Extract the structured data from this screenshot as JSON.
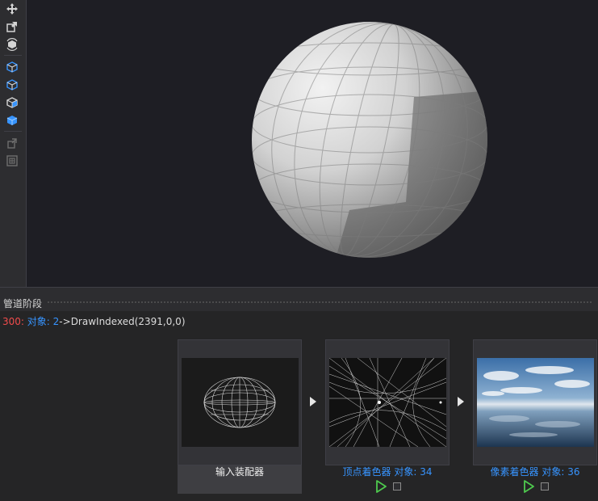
{
  "toolbar": {
    "tools": [
      {
        "name": "move-icon",
        "color": "#d4d4d4"
      },
      {
        "name": "scale-icon",
        "color": "#d4d4d4"
      },
      {
        "name": "rotate-icon",
        "color": "#d4d4d4"
      },
      {
        "name": "cube-view-icon-1",
        "color": "#3794ff"
      },
      {
        "name": "cube-view-icon-2",
        "color": "#3794ff"
      },
      {
        "name": "cube-view-icon-3",
        "color": "#3794ff"
      },
      {
        "name": "cube-solid-icon",
        "color": "#3794ff"
      },
      {
        "name": "export-icon",
        "color": "#6e6e6e"
      },
      {
        "name": "layout-icon",
        "color": "#6e6e6e"
      }
    ]
  },
  "panel": {
    "title": "管道阶段"
  },
  "drawcall": {
    "number": "300:",
    "object_label": "对象:",
    "object_id": "2",
    "arrow": "->",
    "call": "DrawIndexed(2391,0,0)"
  },
  "stages": [
    {
      "label": "输入装配器",
      "active": true
    },
    {
      "label": "顶点着色器 对象: 34",
      "active": false
    },
    {
      "label": "像素着色器 对象: 36",
      "active": false
    }
  ],
  "colors": {
    "accent_blue": "#3794ff",
    "error_red": "#f14c4c",
    "play_green": "#4ec94e",
    "viewport_bg": "#1e1e24"
  }
}
